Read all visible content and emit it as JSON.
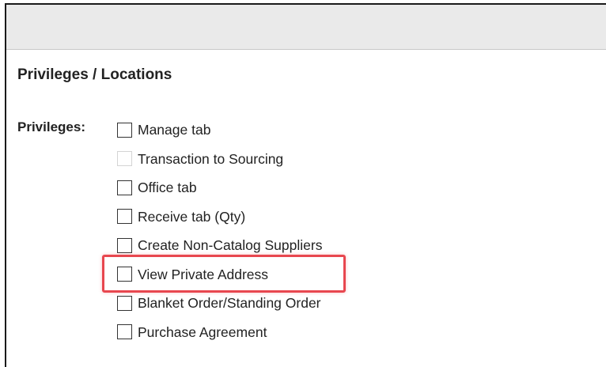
{
  "section": {
    "title": "Privileges / Locations"
  },
  "privileges": {
    "label": "Privileges:",
    "items": [
      {
        "label": "Manage tab",
        "checked": false,
        "enabled": true
      },
      {
        "label": "Transaction to Sourcing",
        "checked": false,
        "enabled": false
      },
      {
        "label": "Office tab",
        "checked": false,
        "enabled": true
      },
      {
        "label": "Receive tab (Qty)",
        "checked": false,
        "enabled": true
      },
      {
        "label": "Create Non-Catalog Suppliers",
        "checked": false,
        "enabled": true
      },
      {
        "label": "View Private Address",
        "checked": false,
        "enabled": true,
        "highlighted": true
      },
      {
        "label": "Blanket Order/Standing Order",
        "checked": false,
        "enabled": true
      },
      {
        "label": "Purchase Agreement",
        "checked": false,
        "enabled": true
      }
    ]
  },
  "colors": {
    "header_bar": "#eaeaea",
    "highlight": "#e8474f",
    "text": "#222222"
  }
}
